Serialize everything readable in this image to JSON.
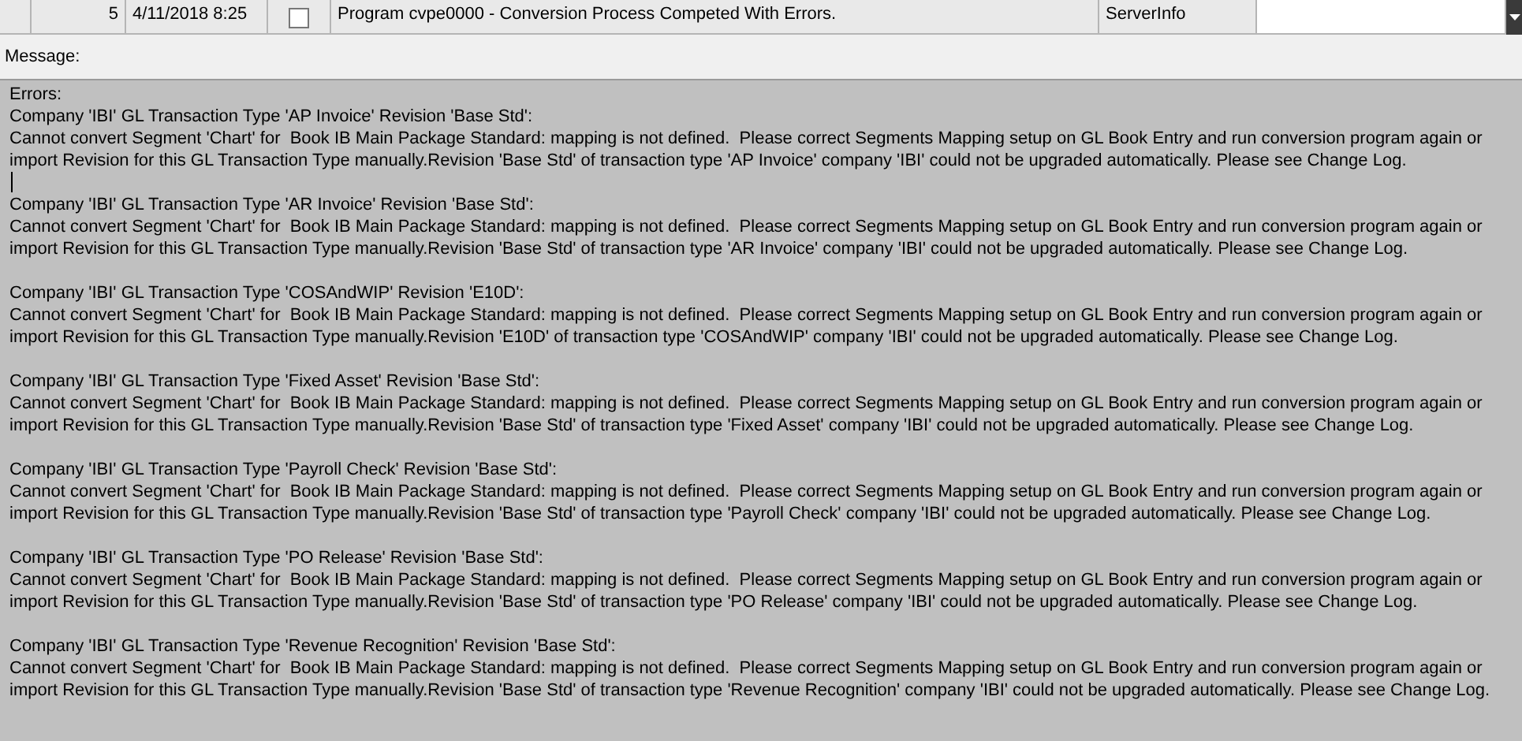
{
  "grid_row": {
    "number": "5",
    "date": "4/11/2018 8:25",
    "checked": false,
    "message": "Program cvpe0000 - Conversion Process Competed With Errors.",
    "source": "ServerInfo"
  },
  "message_label": "Message:",
  "errors": {
    "heading": "Errors:",
    "entries": [
      {
        "heading": "Company 'IBI' GL Transaction Type 'AP Invoice' Revision 'Base Std':",
        "body": "Cannot convert Segment 'Chart' for  Book IB Main Package Standard: mapping is not defined.  Please correct Segments Mapping setup on GL Book Entry and run conversion program again or import Revision for this GL Transaction Type manually.Revision 'Base Std' of transaction type 'AP Invoice' company 'IBI' could not be upgraded automatically. Please see Change Log."
      },
      {
        "heading": "Company 'IBI' GL Transaction Type 'AR Invoice' Revision 'Base Std':",
        "body": "Cannot convert Segment 'Chart' for  Book IB Main Package Standard: mapping is not defined.  Please correct Segments Mapping setup on GL Book Entry and run conversion program again or import Revision for this GL Transaction Type manually.Revision 'Base Std' of transaction type 'AR Invoice' company 'IBI' could not be upgraded automatically. Please see Change Log."
      },
      {
        "heading": "Company 'IBI' GL Transaction Type 'COSAndWIP' Revision 'E10D':",
        "body": "Cannot convert Segment 'Chart' for  Book IB Main Package Standard: mapping is not defined.  Please correct Segments Mapping setup on GL Book Entry and run conversion program again or import Revision for this GL Transaction Type manually.Revision 'E10D' of transaction type 'COSAndWIP' company 'IBI' could not be upgraded automatically. Please see Change Log."
      },
      {
        "heading": "Company 'IBI' GL Transaction Type 'Fixed Asset' Revision 'Base Std':",
        "body": "Cannot convert Segment 'Chart' for  Book IB Main Package Standard: mapping is not defined.  Please correct Segments Mapping setup on GL Book Entry and run conversion program again or import Revision for this GL Transaction Type manually.Revision 'Base Std' of transaction type 'Fixed Asset' company 'IBI' could not be upgraded automatically. Please see Change Log."
      },
      {
        "heading": "Company 'IBI' GL Transaction Type 'Payroll Check' Revision 'Base Std':",
        "body": "Cannot convert Segment 'Chart' for  Book IB Main Package Standard: mapping is not defined.  Please correct Segments Mapping setup on GL Book Entry and run conversion program again or import Revision for this GL Transaction Type manually.Revision 'Base Std' of transaction type 'Payroll Check' company 'IBI' could not be upgraded automatically. Please see Change Log."
      },
      {
        "heading": "Company 'IBI' GL Transaction Type 'PO Release' Revision 'Base Std':",
        "body": "Cannot convert Segment 'Chart' for  Book IB Main Package Standard: mapping is not defined.  Please correct Segments Mapping setup on GL Book Entry and run conversion program again or import Revision for this GL Transaction Type manually.Revision 'Base Std' of transaction type 'PO Release' company 'IBI' could not be upgraded automatically. Please see Change Log."
      },
      {
        "heading": "Company 'IBI' GL Transaction Type 'Revenue Recognition' Revision 'Base Std':",
        "body": "Cannot convert Segment 'Chart' for  Book IB Main Package Standard: mapping is not defined.  Please correct Segments Mapping setup on GL Book Entry and run conversion program again or import Revision for this GL Transaction Type manually.Revision 'Base Std' of transaction type 'Revenue Recognition' company 'IBI' could not be upgraded automatically. Please see Change Log."
      }
    ]
  }
}
